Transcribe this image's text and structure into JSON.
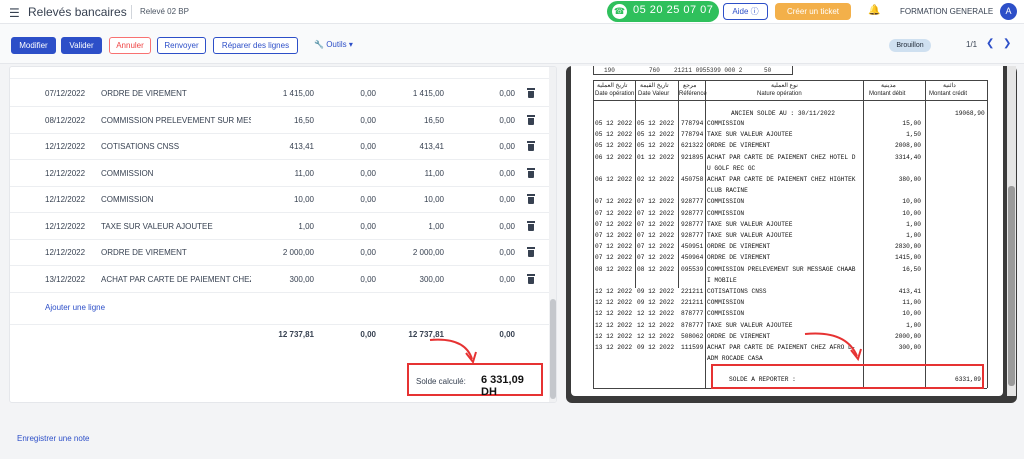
{
  "header": {
    "menu_icon": "hamburger-icon",
    "title": "Relevés bancaires",
    "subtitle": "Relevé 02 BP",
    "phone": "05 20 25 07 07",
    "aide": "Aide",
    "ticket": "Créer un ticket",
    "org": "FORMATION GENERALE",
    "avatar": "A"
  },
  "toolbar": {
    "modifier": "Modifier",
    "valider": "Valider",
    "annuler": "Annuler",
    "renvoyer": "Renvoyer",
    "reparer": "Réparer des lignes",
    "outils": "Outils",
    "status": "Brouillon",
    "pager": "1/1"
  },
  "table": {
    "rows": [
      {
        "date": "07/12/2022",
        "label": "ORDRE DE VIREMENT",
        "amount": "1 415,00",
        "c1": "0,00",
        "c2": "1 415,00",
        "c3": "0,00"
      },
      {
        "date": "08/12/2022",
        "label": "COMMISSION PRELEVEMENT SUR MESS...",
        "amount": "16,50",
        "c1": "0,00",
        "c2": "16,50",
        "c3": "0,00"
      },
      {
        "date": "12/12/2022",
        "label": "COTISATIONS CNSS",
        "amount": "413,41",
        "c1": "0,00",
        "c2": "413,41",
        "c3": "0,00"
      },
      {
        "date": "12/12/2022",
        "label": "COMMISSION",
        "amount": "11,00",
        "c1": "0,00",
        "c2": "11,00",
        "c3": "0,00"
      },
      {
        "date": "12/12/2022",
        "label": "COMMISSION",
        "amount": "10,00",
        "c1": "0,00",
        "c2": "10,00",
        "c3": "0,00"
      },
      {
        "date": "12/12/2022",
        "label": "TAXE SUR VALEUR AJOUTEE",
        "amount": "1,00",
        "c1": "0,00",
        "c2": "1,00",
        "c3": "0,00"
      },
      {
        "date": "12/12/2022",
        "label": "ORDRE DE VIREMENT",
        "amount": "2 000,00",
        "c1": "0,00",
        "c2": "2 000,00",
        "c3": "0,00"
      },
      {
        "date": "13/12/2022",
        "label": "ACHAT PAR CARTE DE PAIEMENT CHEZ ...",
        "amount": "300,00",
        "c1": "0,00",
        "c2": "300,00",
        "c3": "0,00"
      }
    ],
    "add_line": "Ajouter une ligne",
    "totals": {
      "amount": "12 737,81",
      "c1": "0,00",
      "c2": "12 737,81",
      "c3": "0,00"
    },
    "solde_label": "Solde calculé:",
    "solde_value": "6 331,09 DH"
  },
  "document": {
    "top_strip": [
      "190",
      "760",
      "21211 0955399 000 2",
      "50"
    ],
    "headers_ar": [
      "تاريخ العملية",
      "تاريخ القيمة",
      "مرجع",
      "نوع العملية",
      "مدينية",
      "دائنية"
    ],
    "headers_fr": [
      "Date opération",
      "Date Valeur",
      "Référence",
      "Nature opération",
      "Montant débit",
      "Montant crédit"
    ],
    "ancien_solde": "ANCIEN  SOLDE AU : 30/11/2022",
    "ancien_solde_value": "19068,90",
    "lines": [
      {
        "d1": "05 12 2022",
        "d2": "05 12 2022",
        "ref": "778794",
        "nat": "COMMISSION",
        "debit": "15,00"
      },
      {
        "d1": "05 12 2022",
        "d2": "05 12 2022",
        "ref": "778794",
        "nat": "TAXE SUR VALEUR AJOUTEE",
        "debit": "1,50"
      },
      {
        "d1": "05 12 2022",
        "d2": "05 12 2022",
        "ref": "621322",
        "nat": "ORDRE DE VIREMENT",
        "debit": "2008,00"
      },
      {
        "d1": "06 12 2022",
        "d2": "01 12 2022",
        "ref": "921895",
        "nat": "ACHAT PAR CARTE DE PAIEMENT CHEZ HOTEL D",
        "debit": "3314,40"
      },
      {
        "d1": "",
        "d2": "",
        "ref": "",
        "nat": "U GOLF REC GC",
        "debit": ""
      },
      {
        "d1": "06 12 2022",
        "d2": "02 12 2022",
        "ref": "450758",
        "nat": "ACHAT PAR CARTE DE PAIEMENT CHEZ HIGHTEK",
        "debit": "380,00"
      },
      {
        "d1": "",
        "d2": "",
        "ref": "",
        "nat": "CLUB RACINE",
        "debit": ""
      },
      {
        "d1": "07 12 2022",
        "d2": "07 12 2022",
        "ref": "928777",
        "nat": "COMMISSION",
        "debit": "10,00"
      },
      {
        "d1": "07 12 2022",
        "d2": "07 12 2022",
        "ref": "928777",
        "nat": "COMMISSION",
        "debit": "10,00"
      },
      {
        "d1": "07 12 2022",
        "d2": "07 12 2022",
        "ref": "928777",
        "nat": "TAXE SUR VALEUR AJOUTEE",
        "debit": "1,00"
      },
      {
        "d1": "07 12 2022",
        "d2": "07 12 2022",
        "ref": "928777",
        "nat": "TAXE SUR VALEUR AJOUTEE",
        "debit": "1,00"
      },
      {
        "d1": "07 12 2022",
        "d2": "07 12 2022",
        "ref": "450951",
        "nat": "ORDRE DE VIREMENT",
        "debit": "2830,00"
      },
      {
        "d1": "07 12 2022",
        "d2": "07 12 2022",
        "ref": "450964",
        "nat": "ORDRE DE VIREMENT",
        "debit": "1415,00"
      },
      {
        "d1": "08 12 2022",
        "d2": "08 12 2022",
        "ref": "095539",
        "nat": "COMMISSION PRELEVEMENT SUR MESSAGE CHAAB",
        "debit": "16,50"
      },
      {
        "d1": "",
        "d2": "",
        "ref": "",
        "nat": "I MOBILE",
        "debit": ""
      },
      {
        "d1": "12 12 2022",
        "d2": "09 12 2022",
        "ref": "221211",
        "nat": "COTISATIONS CNSS",
        "debit": "413,41"
      },
      {
        "d1": "12 12 2022",
        "d2": "09 12 2022",
        "ref": "221211",
        "nat": "COMMISSION",
        "debit": "11,00"
      },
      {
        "d1": "12 12 2022",
        "d2": "12 12 2022",
        "ref": "878777",
        "nat": "COMMISSION",
        "debit": "10,00"
      },
      {
        "d1": "12 12 2022",
        "d2": "12 12 2022",
        "ref": "878777",
        "nat": "TAXE SUR VALEUR AJOUTEE",
        "debit": "1,00"
      },
      {
        "d1": "12 12 2022",
        "d2": "12 12 2022",
        "ref": "508062",
        "nat": "ORDRE DE VIREMENT",
        "debit": "2000,00"
      },
      {
        "d1": "13 12 2022",
        "d2": "09 12 2022",
        "ref": "111599",
        "nat": "ACHAT PAR CARTE DE PAIEMENT CHEZ AFRO D-",
        "debit": "300,00"
      },
      {
        "d1": "",
        "d2": "",
        "ref": "",
        "nat": "ADM ROCADE CASA",
        "debit": ""
      }
    ],
    "solde_reporter_label": "SOLDE A REPORTER :",
    "solde_reporter_value": "6331,09"
  },
  "footer": {
    "note": "Enregistrer une note"
  },
  "colors": {
    "primary": "#2d4fc8",
    "phone": "#2fc05c",
    "ticket": "#f3b04a",
    "highlight": "#e63232"
  }
}
